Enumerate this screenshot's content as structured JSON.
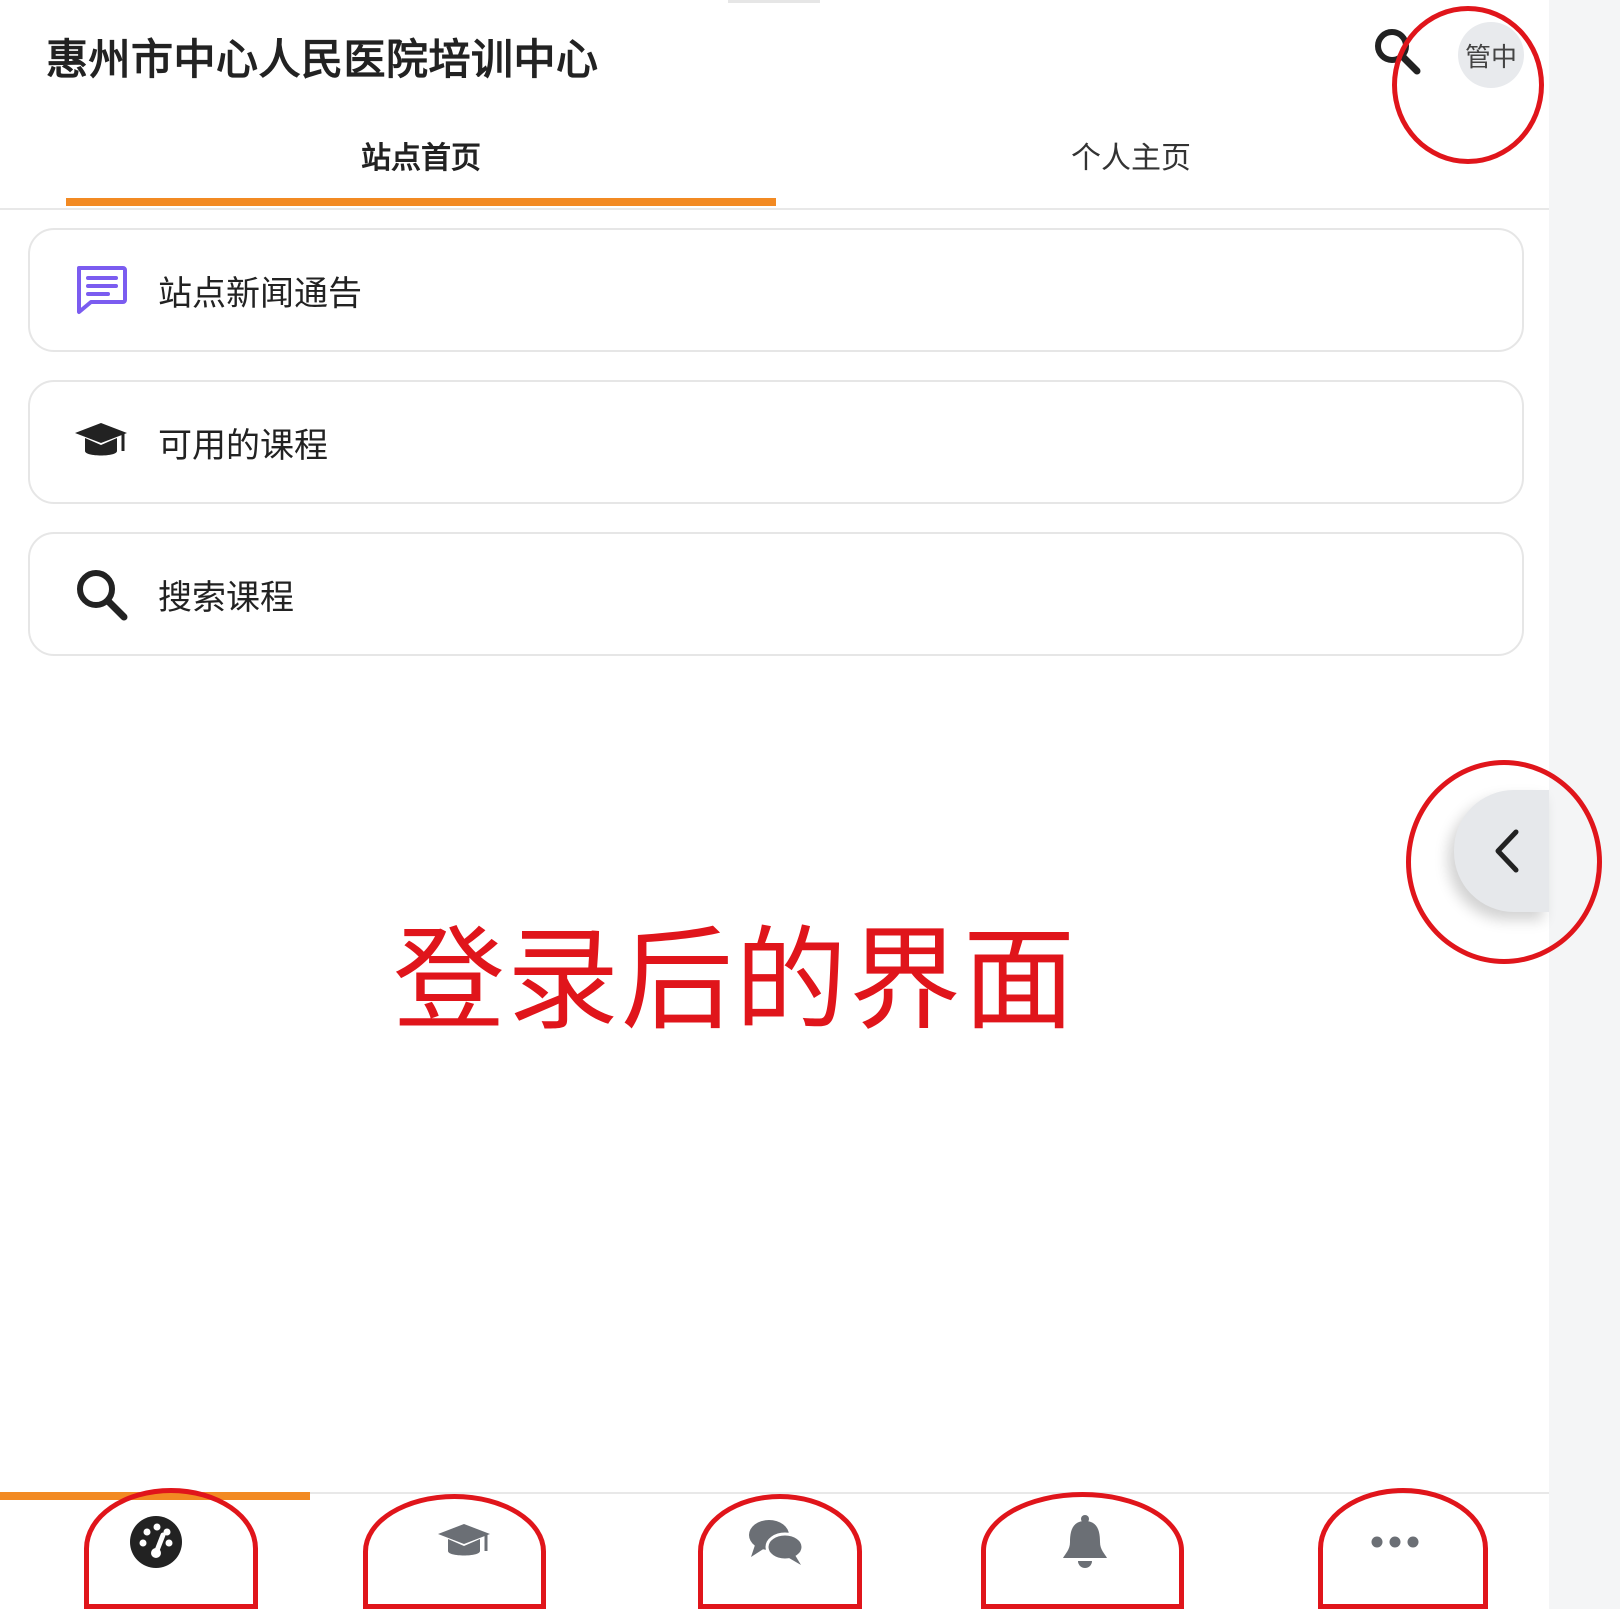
{
  "header": {
    "title": "惠州市中心人民医院培训中心",
    "search_icon": "search-icon",
    "avatar_text": "管中"
  },
  "tabs": [
    {
      "label": "站点首页",
      "active": true
    },
    {
      "label": "个人主页",
      "active": false
    }
  ],
  "menu": [
    {
      "label": "站点新闻通告",
      "icon": "chat-message-icon"
    },
    {
      "label": "可用的课程",
      "icon": "graduation-cap-icon"
    },
    {
      "label": "搜索课程",
      "icon": "search-icon"
    }
  ],
  "drawer_toggle": {
    "icon": "chevron-left-icon"
  },
  "annotation": {
    "text": "登录后的界面",
    "color": "#e0151b"
  },
  "bottom_nav": [
    {
      "name": "dashboard",
      "icon": "dashboard-gauge-icon",
      "active": true
    },
    {
      "name": "courses",
      "icon": "graduation-cap-icon",
      "active": false
    },
    {
      "name": "messages",
      "icon": "chat-bubbles-icon",
      "active": false
    },
    {
      "name": "notifications",
      "icon": "bell-icon",
      "active": false
    },
    {
      "name": "more",
      "icon": "more-dots-icon",
      "active": false
    }
  ],
  "colors": {
    "accent": "#f28a23",
    "annotation_red": "#e0151b",
    "news_icon": "#7b5cf0"
  }
}
